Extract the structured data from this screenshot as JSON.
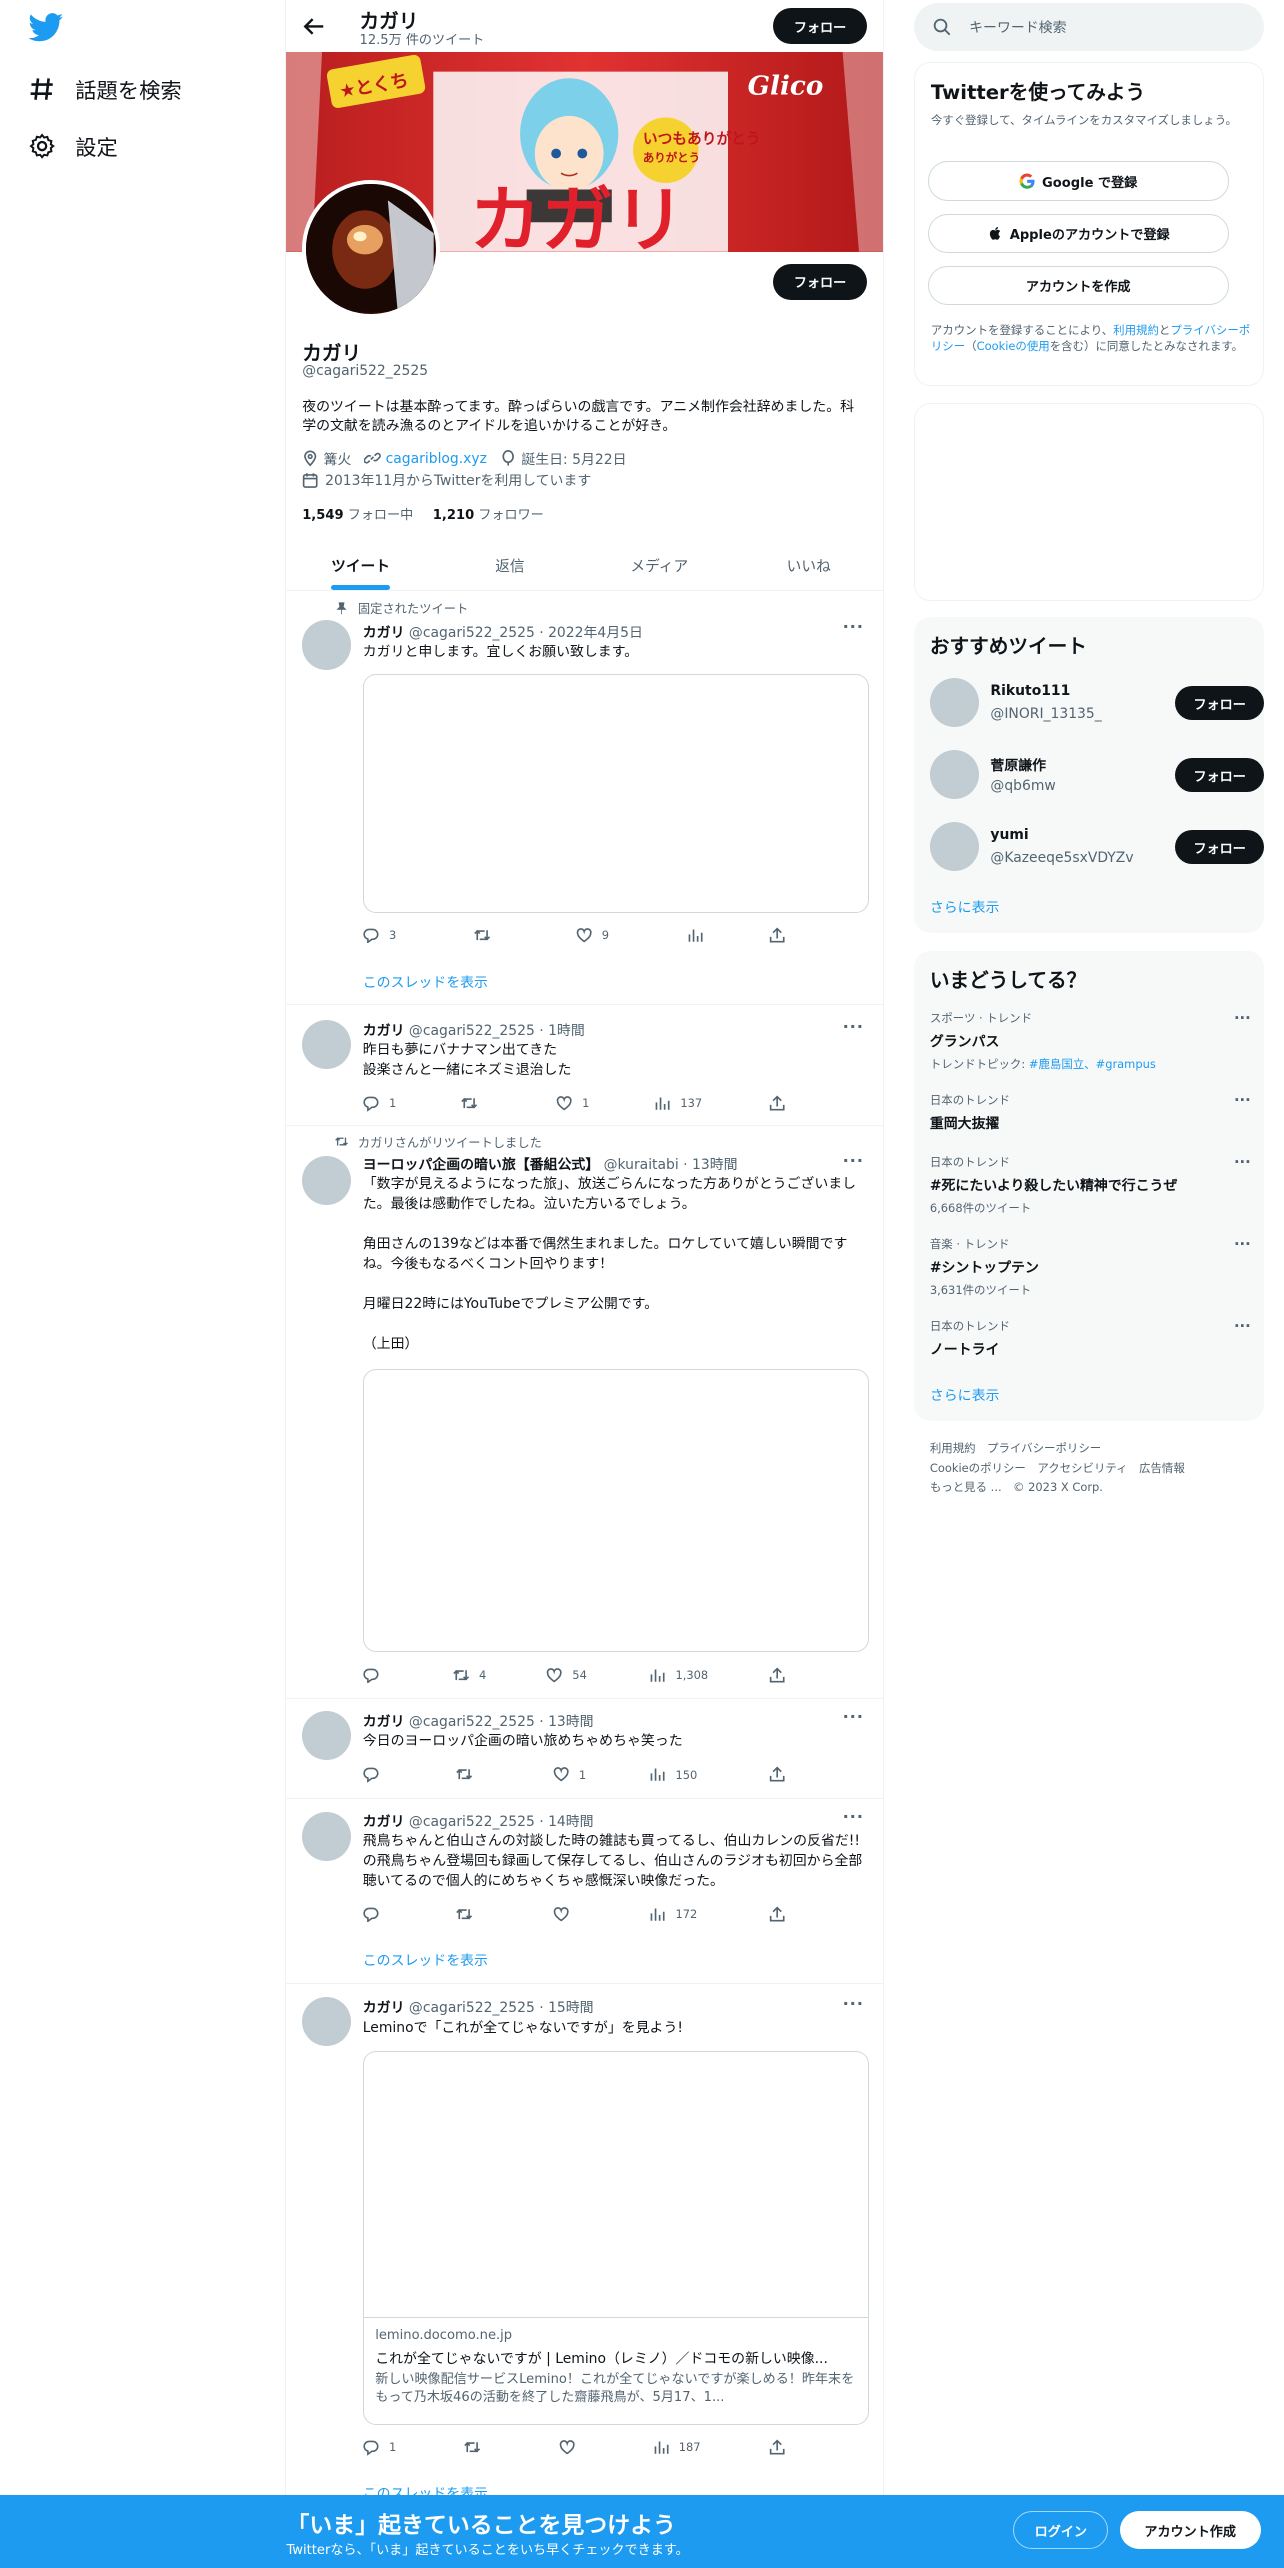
{
  "nav": {
    "explore_label": "話題を検索",
    "settings_label": "設定"
  },
  "header": {
    "name": "カガリ",
    "tweet_count": "12.5万 件のツイート",
    "follow_label": "フォロー"
  },
  "profile": {
    "name": "カガリ",
    "handle": "@cagari522_2525",
    "bio": "夜のツイートは基本酔ってます。酔っぱらいの戯言です。アニメ制作会社辞めました。科学の文献を読み漁るのとアイドルを追いかけることが好き。",
    "location": "篝火",
    "website": "cagariblog.xyz",
    "birthday": "誕生日: 5月22日",
    "joined": "2013年11月からTwitterを利用しています",
    "following_count": "1,549",
    "following_label": "フォロー中",
    "followers_count": "1,210",
    "followers_label": "フォロワー",
    "follow_label": "フォロー",
    "banner_text": "カガリ",
    "banner_sub": "いつもありがとう",
    "banner_tag": "ありがとう",
    "banner_brand": "Glico"
  },
  "tabs": [
    "ツイート",
    "返信",
    "メディア",
    "いいね"
  ],
  "tweets": [
    {
      "context": "固定されたツイート",
      "name": "カガリ",
      "handle": "@cagari522_2525",
      "time": "2022年4月5日",
      "text": "カガリと申します。宜しくお願い致します。",
      "reply": "3",
      "retweet": "",
      "like": "9",
      "views": "",
      "thread": "このスレッドを表示"
    },
    {
      "name": "カガリ",
      "handle": "@cagari522_2525",
      "time": "1時間",
      "text": "昨日も夢にバナナマン出てきた\n設楽さんと一緒にネズミ退治した",
      "reply": "1",
      "retweet": "",
      "like": "1",
      "views": "137"
    },
    {
      "context": "カガリさんがリツイートしました",
      "name": "ヨーロッパ企画の暗い旅【番組公式】",
      "handle": "@kuraitabi",
      "time": "13時間",
      "text": "「数字が見えるようになった旅」、放送ごらんになった方ありがとうございました。最後は感動作でしたね。泣いた方いるでしょう。\n\n角田さんの139などは本番で偶然生まれました。ロケしていて嬉しい瞬間ですね。今後もなるべくコント回やります！\n\n月曜日22時にはYouTubeでプレミア公開です。\n\n（上田）",
      "reply": "",
      "retweet": "4",
      "like": "54",
      "views": "1,308"
    },
    {
      "name": "カガリ",
      "handle": "@cagari522_2525",
      "time": "13時間",
      "text": "今日のヨーロッパ企画の暗い旅めちゃめちゃ笑った",
      "reply": "",
      "retweet": "",
      "like": "1",
      "views": "150"
    },
    {
      "name": "カガリ",
      "handle": "@cagari522_2525",
      "time": "14時間",
      "text": "飛鳥ちゃんと伯山さんの対談した時の雑誌も買ってるし、伯山カレンの反省だ!!の飛鳥ちゃん登場回も録画して保存してるし、伯山さんのラジオも初回から全部聴いてるので個人的にめちゃくちゃ感慨深い映像だった。",
      "reply": "",
      "retweet": "",
      "like": "",
      "views": "172",
      "thread": "このスレッドを表示"
    },
    {
      "name": "カガリ",
      "handle": "@cagari522_2525",
      "time": "15時間",
      "text": "Leminoで「これが全てじゃないですが」を見よう!",
      "reply": "1",
      "retweet": "",
      "like": "",
      "views": "187",
      "thread": "このスレッドを表示",
      "card": {
        "domain": "lemino.docomo.ne.jp",
        "title": "これが全てじゃないですが | Lemino（レミノ）／ドコモの新しい映像...",
        "desc": "新しい映像配信サービスLemino！これが全てじゃないですが楽しめる！昨年末をもって乃木坂46の活動を終了した齋藤飛鳥が、5月17、1..."
      }
    }
  ],
  "sidebar": {
    "search_placeholder": "キーワード検索",
    "signup": {
      "title": "Twitterを使ってみよう",
      "subtitle": "今すぐ登録して、タイムラインをカスタマイズしましょう。",
      "google": "Google で登録",
      "apple": "Appleのアカウントで登録",
      "create": "アカウントを作成",
      "legal_pre": "アカウントを登録することにより、",
      "legal_terms": "利用規約",
      "legal_and": "と",
      "legal_privacy": "プライバシーポリシー",
      "legal_mid": "（",
      "legal_cookie": "Cookieの使用",
      "legal_post": "を含む）に同意したとみなされます。"
    },
    "recommended": {
      "title": "おすすめツイート",
      "users": [
        {
          "name": "Rikuto111",
          "handle": "@INORI_13135_"
        },
        {
          "name": "菅原謙作",
          "handle": "@qb6mw"
        },
        {
          "name": "yumi",
          "handle": "@Kazeeqe5sxVDYZv"
        }
      ],
      "follow_label": "フォロー",
      "show_more": "さらに表示"
    },
    "trends": {
      "title": "いまどうしてる？",
      "items": [
        {
          "category": "スポーツ · トレンド",
          "name": "グランパス",
          "extra_pre": "トレンドトピック: ",
          "extra_links": "#鹿島国立、#grampus"
        },
        {
          "category": "日本のトレンド",
          "name": "重岡大抜擢",
          "extra_pre": "",
          "extra_links": ""
        },
        {
          "category": "日本のトレンド",
          "name": "#死にたいより殺したい精神で行こうぜ",
          "extra_pre": "6,668件のツイート",
          "extra_links": ""
        },
        {
          "category": "音楽 · トレンド",
          "name": "#シントップテン",
          "extra_pre": "3,631件のツイート",
          "extra_links": ""
        },
        {
          "category": "日本のトレンド",
          "name": "ノートライ",
          "extra_pre": "",
          "extra_links": ""
        }
      ],
      "show_more": "さらに表示"
    },
    "footer": {
      "l1": "利用規約",
      "l2": "プライバシーポリシー",
      "l3": "Cookieのポリシー",
      "l4": "アクセシビリティ",
      "l5": "広告情報",
      "l6": "もっと見る ...",
      "l7": "© 2023 X Corp."
    }
  },
  "bottombar": {
    "title": "「いま」起きていることを見つけよう",
    "subtitle": "Twitterなら、「いま」起きていることをいち早くチェックできます。",
    "login": "ログイン",
    "signup": "アカウント作成"
  },
  "colors": {
    "accent": "#1d9bf0",
    "text": "#0f1419",
    "muted": "#536471"
  }
}
